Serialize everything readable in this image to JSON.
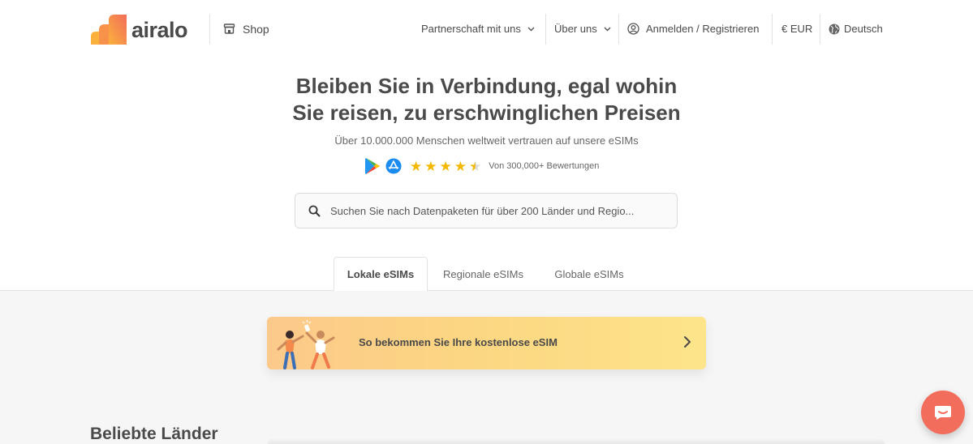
{
  "header": {
    "logo_text": "airalo",
    "shop_label": "Shop",
    "partnership_label": "Partnerschaft mit uns",
    "about_label": "Über uns",
    "login_label": "Anmelden / Registrieren",
    "currency_label": "€ EUR",
    "language_label": "Deutsch"
  },
  "hero": {
    "title_line1": "Bleiben Sie in Verbindung, egal wohin",
    "title_line2": "Sie reisen, zu erschwinglichen Preisen",
    "subtitle": "Über 10.000.000 Menschen weltweit vertrauen auf unsere eSIMs",
    "rating_stars": 4.5,
    "rating_text": "Von 300,000+ Bewertungen"
  },
  "search": {
    "placeholder": "Suchen Sie nach Datenpaketen für über 200 Länder und Regio..."
  },
  "tabs": [
    {
      "label": "Lokale eSIMs",
      "active": true
    },
    {
      "label": "Regionale eSIMs",
      "active": false
    },
    {
      "label": "Globale eSIMs",
      "active": false
    }
  ],
  "banner": {
    "text": "So bekommen Sie Ihre kostenlose eSIM"
  },
  "section": {
    "title": "Beliebte Länder"
  },
  "colors": {
    "brand_coral": "#f26d5b",
    "brand_orange": "#f9a03f",
    "star": "#f5b800",
    "text": "#4a4a4a"
  },
  "icons": {
    "shop": "store-icon",
    "user": "user-circle-icon",
    "globe": "globe-icon",
    "search": "search-icon",
    "chat": "chat-icon"
  }
}
